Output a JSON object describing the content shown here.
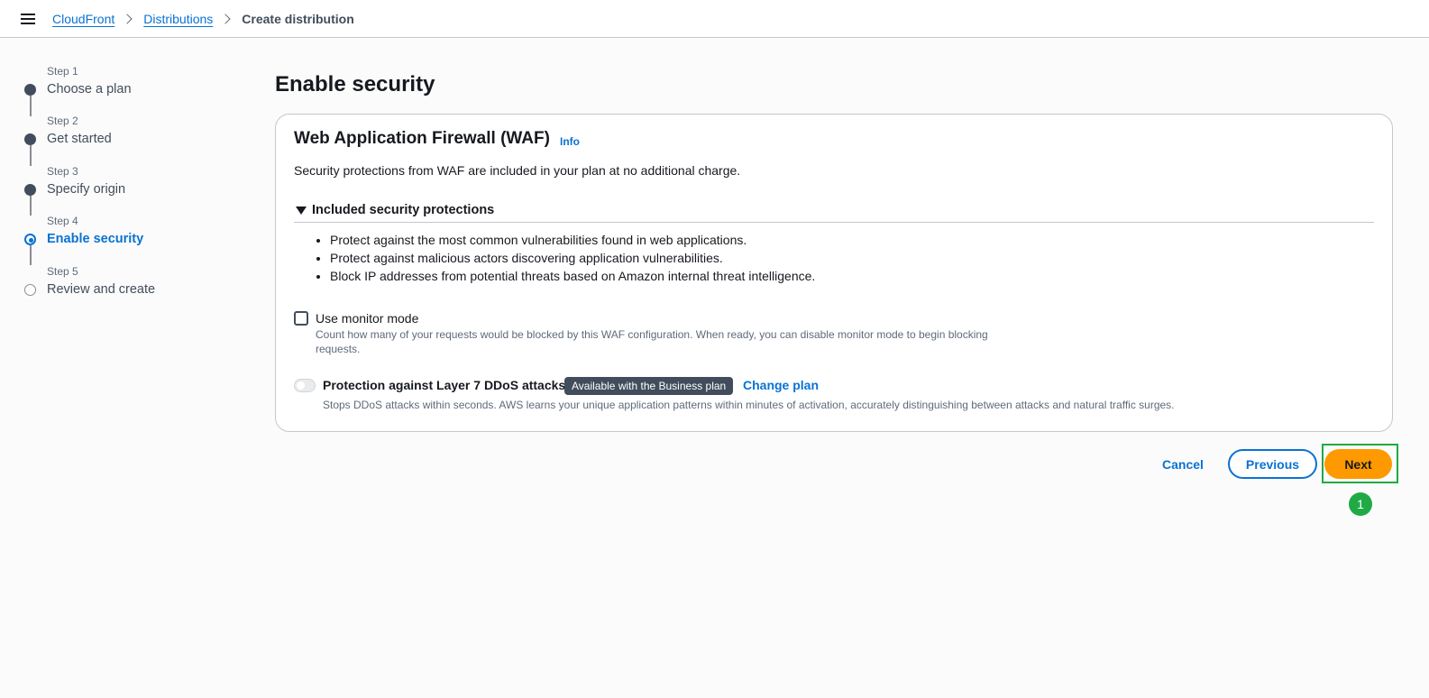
{
  "breadcrumb": {
    "items": [
      {
        "label": "CloudFront"
      },
      {
        "label": "Distributions"
      },
      {
        "label": "Create distribution"
      }
    ]
  },
  "steps": [
    {
      "number": "Step 1",
      "title": "Choose a plan",
      "state": "completed"
    },
    {
      "number": "Step 2",
      "title": "Get started",
      "state": "completed"
    },
    {
      "number": "Step 3",
      "title": "Specify origin",
      "state": "completed"
    },
    {
      "number": "Step 4",
      "title": "Enable security",
      "state": "current"
    },
    {
      "number": "Step 5",
      "title": "Review and create",
      "state": "upcoming"
    }
  ],
  "page": {
    "title": "Enable security"
  },
  "waf": {
    "title": "Web Application Firewall (WAF)",
    "info_label": "Info",
    "description": "Security protections from WAF are included in your plan at no additional charge.",
    "expandable": {
      "title": "Included security protections",
      "expanded": true,
      "items": [
        "Protect against the most common vulnerabilities found in web applications.",
        "Protect against malicious actors discovering application vulnerabilities.",
        "Block IP addresses from potential threats based on Amazon internal threat intelligence."
      ]
    },
    "monitor_mode": {
      "label": "Use monitor mode",
      "checked": false,
      "description": "Count how many of your requests would be blocked by this WAF configuration. When ready, you can disable monitor mode to begin blocking requests."
    },
    "ddos": {
      "label": "Protection against Layer 7 DDoS attacks",
      "enabled": false,
      "badge": "Available with the Business plan",
      "change_plan_label": "Change plan",
      "description": "Stops DDoS attacks within seconds. AWS learns your unique application patterns within minutes of activation, accurately distinguishing between attacks and natural traffic surges."
    }
  },
  "actions": {
    "cancel_label": "Cancel",
    "previous_label": "Previous",
    "next_label": "Next"
  },
  "annotation": {
    "marker_label": "1"
  },
  "colors": {
    "link": "#0972d3",
    "primary_button": "#ff9900",
    "highlight": "#1faa45",
    "badge": "#414d5c"
  }
}
